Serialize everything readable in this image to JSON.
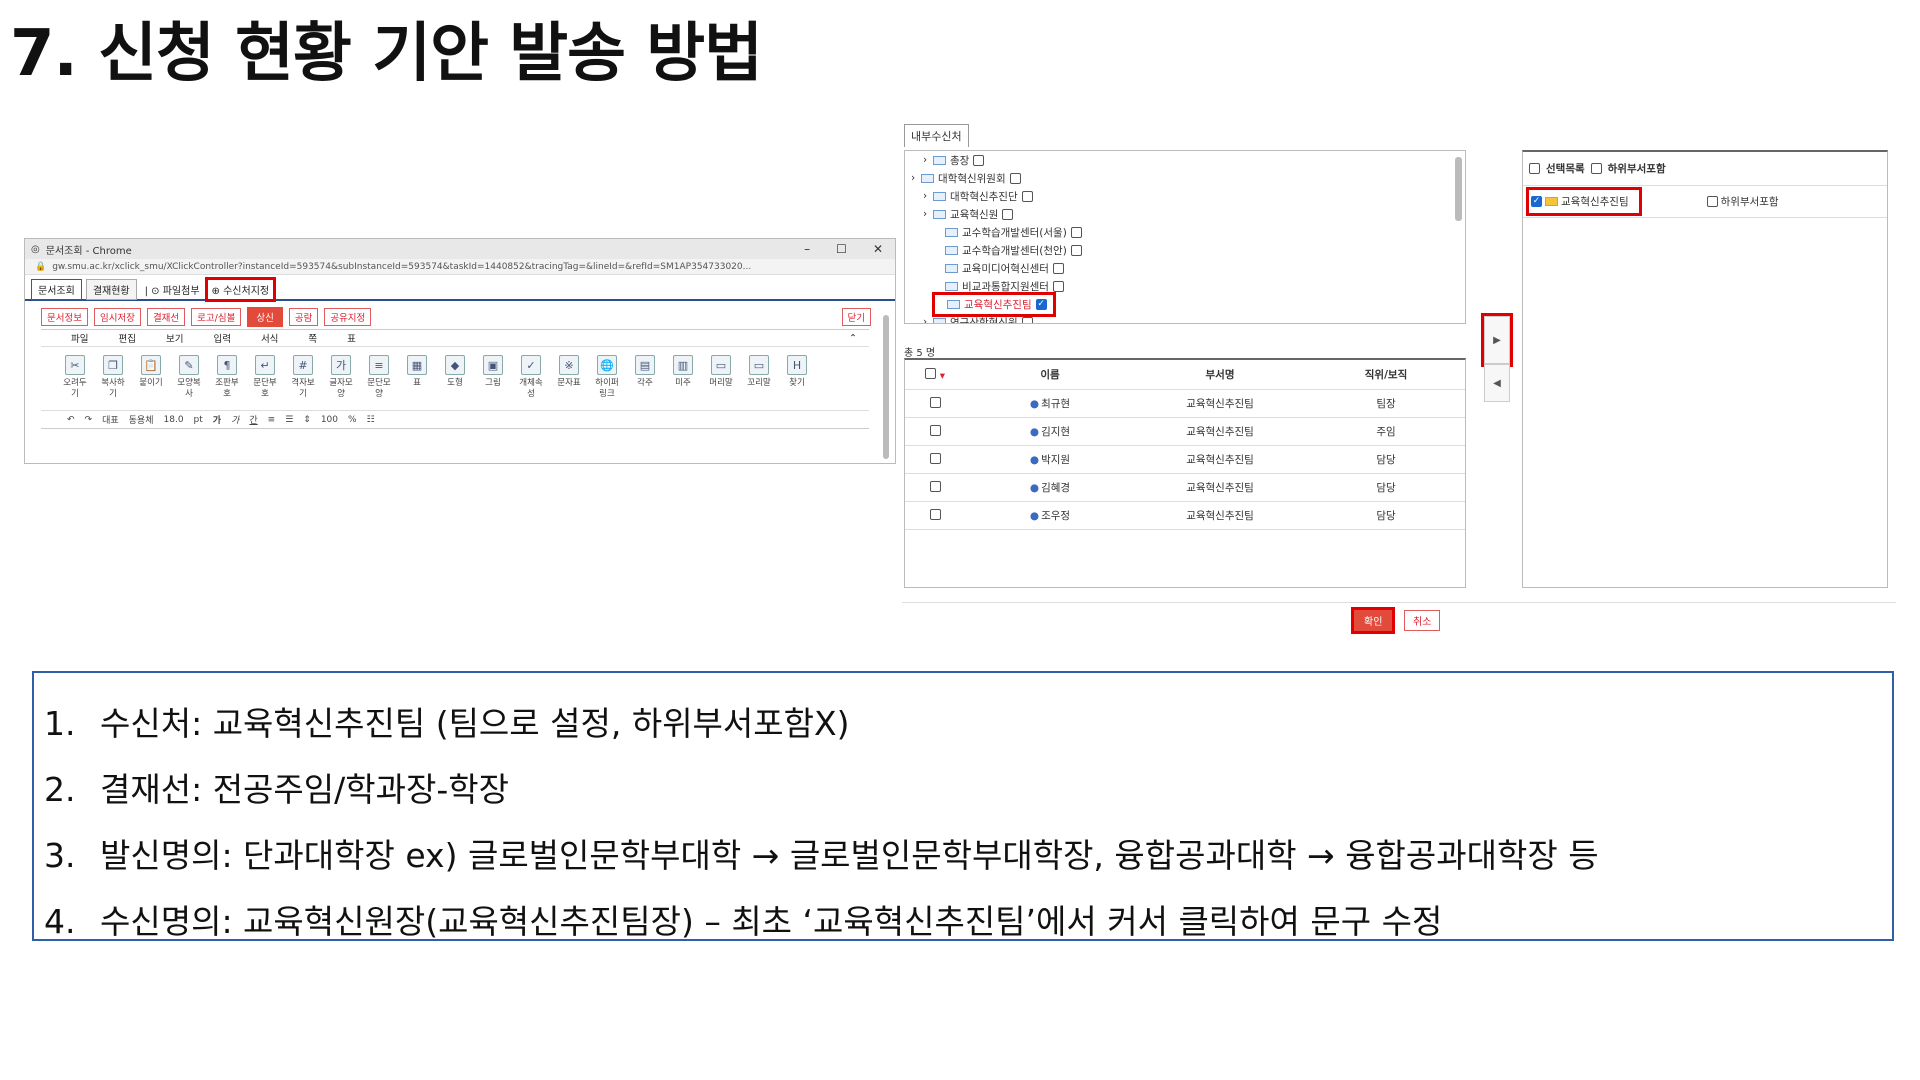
{
  "page": {
    "title": "7. 신청 현황 기안 발송 방법"
  },
  "browser": {
    "window_title": "문서조회 - Chrome",
    "url": "gw.smu.ac.kr/xclick_smu/XClickController?instanceId=593574&subInstanceId=593574&taskId=1440852&tracingTag=&lineId=&refId=SM1AP354733020...",
    "tabs": [
      "문서조회",
      "결재현황"
    ],
    "tab_links": [
      "파일첨부",
      "수신처지정"
    ],
    "action_buttons": [
      "문서정보",
      "임시저장",
      "결재선",
      "로고/심볼",
      "상신",
      "공람",
      "공유지정"
    ],
    "close_label": "닫기",
    "menus": [
      "파일",
      "편집",
      "보기",
      "입력",
      "서식",
      "쪽",
      "표"
    ],
    "tools": [
      {
        "label": "오려두기",
        "icon": "scissors-icon",
        "glyph": "✂"
      },
      {
        "label": "복사하기",
        "icon": "copy-icon",
        "glyph": "❐"
      },
      {
        "label": "붙이기",
        "icon": "paste-icon",
        "glyph": "📋"
      },
      {
        "label": "모양복사",
        "icon": "format-copy-icon",
        "glyph": "✎"
      },
      {
        "label": "조판부호",
        "icon": "markup-icon",
        "glyph": "¶"
      },
      {
        "label": "문단부호",
        "icon": "paragraph-mark-icon",
        "glyph": "↵"
      },
      {
        "label": "격자보기",
        "icon": "grid-icon",
        "glyph": "#"
      },
      {
        "label": "글자모양",
        "icon": "char-shape-icon",
        "glyph": "가"
      },
      {
        "label": "문단모양",
        "icon": "para-shape-icon",
        "glyph": "≡"
      },
      {
        "label": "표",
        "icon": "table-icon",
        "glyph": "▦"
      },
      {
        "label": "도형",
        "icon": "shape-icon",
        "glyph": "◆"
      },
      {
        "label": "그림",
        "icon": "image-icon",
        "glyph": "▣"
      },
      {
        "label": "개체속성",
        "icon": "object-props-icon",
        "glyph": "✓"
      },
      {
        "label": "문자표",
        "icon": "symbol-icon",
        "glyph": "※"
      },
      {
        "label": "하이퍼링크",
        "icon": "hyperlink-icon",
        "glyph": "🌐"
      },
      {
        "label": "각주",
        "icon": "footnote-icon",
        "glyph": "▤"
      },
      {
        "label": "미주",
        "icon": "endnote-icon",
        "glyph": "▥"
      },
      {
        "label": "머리말",
        "icon": "header-icon",
        "glyph": "▭"
      },
      {
        "label": "꼬리말",
        "icon": "footer-icon",
        "glyph": "▭"
      },
      {
        "label": "찾기",
        "icon": "find-icon",
        "glyph": "H"
      }
    ],
    "format": {
      "style": "대표",
      "font": "동용체",
      "size": "18.0",
      "unit": "pt",
      "zoom": "100",
      "zoom_unit": "%"
    }
  },
  "dialog": {
    "section_label": "내부수신처",
    "tree": [
      {
        "label": "총장",
        "checked": false,
        "depth": 1
      },
      {
        "label": "대학혁신위원회",
        "checked": false,
        "depth": 0
      },
      {
        "label": "대학혁신추진단",
        "checked": false,
        "depth": 1
      },
      {
        "label": "교육혁신원",
        "checked": false,
        "depth": 1
      },
      {
        "label": "교수학습개발센터(서울)",
        "checked": false,
        "depth": 2
      },
      {
        "label": "교수학습개발센터(천안)",
        "checked": false,
        "depth": 2
      },
      {
        "label": "교육미디어혁신센터",
        "checked": false,
        "depth": 2
      },
      {
        "label": "비교과통합지원센터",
        "checked": false,
        "depth": 2
      },
      {
        "label": "교육혁신추진팀",
        "checked": true,
        "depth": 2
      },
      {
        "label": "연구산학혁신원",
        "checked": false,
        "depth": 1
      }
    ],
    "count_label": "총 5 명",
    "columns": [
      "이름",
      "부서명",
      "직위/보직"
    ],
    "rows": [
      {
        "name": "최규현",
        "dept": "교육혁신추진팀",
        "position": "팀장"
      },
      {
        "name": "김지현",
        "dept": "교육혁신추진팀",
        "position": "주임"
      },
      {
        "name": "박지원",
        "dept": "교육혁신추진팀",
        "position": "담당"
      },
      {
        "name": "김혜경",
        "dept": "교육혁신추진팀",
        "position": "담당"
      },
      {
        "name": "조우정",
        "dept": "교육혁신추진팀",
        "position": "담당"
      }
    ],
    "selected_header": {
      "select_list": "선택목록",
      "include_sub": "하위부서포함"
    },
    "selected_item": {
      "label": "교육혁신추진팀",
      "include_sub": "하위부서포함"
    },
    "ok_label": "확인",
    "cancel_label": "취소"
  },
  "notes": [
    {
      "num": "1.",
      "text": "수신처: 교육혁신추진팀 (팀으로 설정, 하위부서포함X)"
    },
    {
      "num": "2.",
      "text": "결재선: 전공주임/학과장-학장"
    },
    {
      "num": "3.",
      "text": "발신명의: 단과대학장 ex) 글로벌인문학부대학 → 글로벌인문학부대학장, 융합공과대학 → 융합공과대학장 등"
    },
    {
      "num": "4.",
      "text": "수신명의: 교육혁신원장(교육혁신추진팀장) – 최초 ‘교육혁신추진팀’에서 커서 클릭하여 문구 수정"
    }
  ],
  "colors": {
    "accent_red": "#e24a3b",
    "highlight_red": "#e00000",
    "note_border": "#2f5fa8"
  }
}
